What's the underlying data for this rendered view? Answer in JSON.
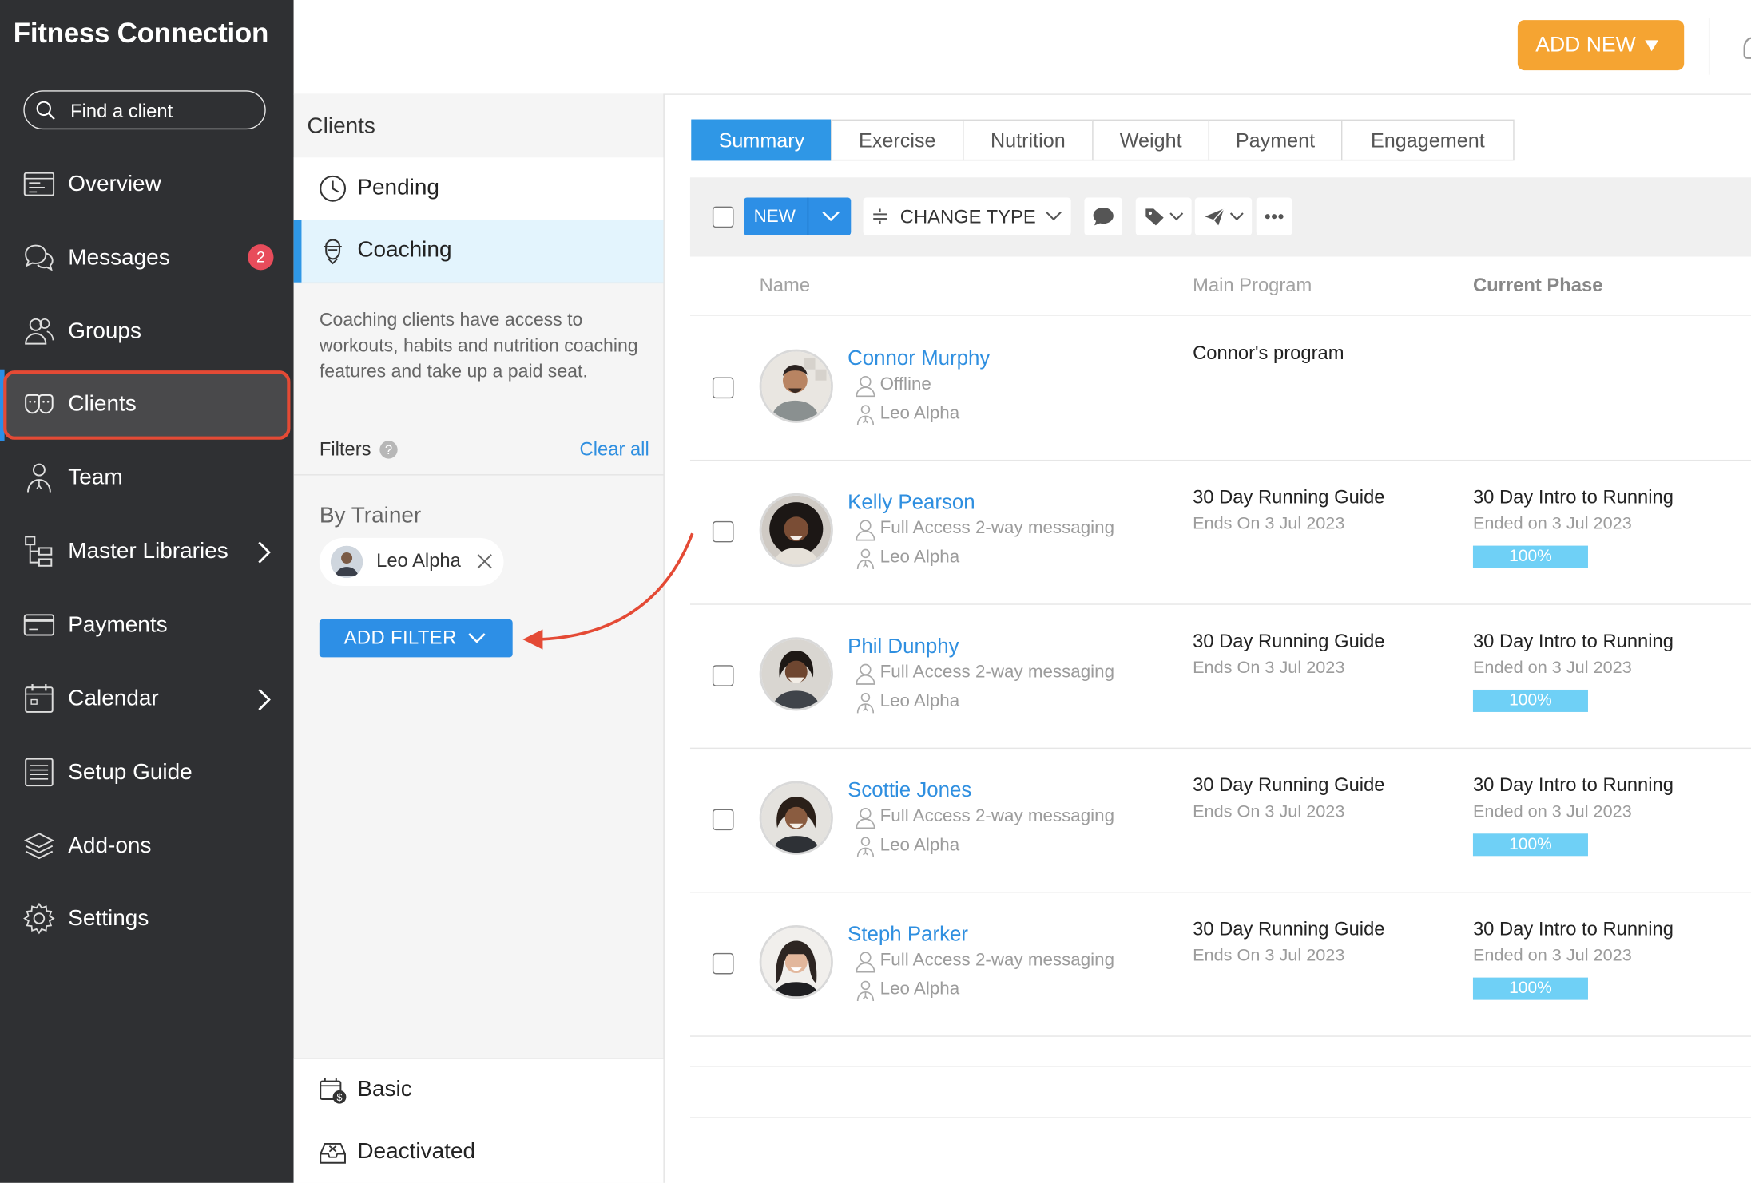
{
  "app": {
    "title": "Fitness Connection",
    "search_placeholder": "Find a client"
  },
  "sidebar": {
    "items": [
      {
        "label": "Overview",
        "icon": "overview-icon"
      },
      {
        "label": "Messages",
        "icon": "messages-icon",
        "badge": "2"
      },
      {
        "label": "Groups",
        "icon": "groups-icon"
      },
      {
        "label": "Clients",
        "icon": "clients-icon",
        "active": true
      },
      {
        "label": "Team",
        "icon": "team-icon"
      },
      {
        "label": "Master Libraries",
        "icon": "master-libraries-icon",
        "has_submenu": true
      },
      {
        "label": "Payments",
        "icon": "payments-icon"
      },
      {
        "label": "Calendar",
        "icon": "calendar-icon",
        "has_submenu": true
      },
      {
        "label": "Setup Guide",
        "icon": "setup-guide-icon"
      },
      {
        "label": "Add-ons",
        "icon": "add-ons-icon"
      },
      {
        "label": "Settings",
        "icon": "settings-icon"
      }
    ],
    "highlight_color": "#e44a35"
  },
  "topbar": {
    "add_new_label": "ADD NEW",
    "add_new_color": "#f5a432"
  },
  "clients_panel": {
    "title": "Clients",
    "segments": [
      {
        "label": "Pending",
        "icon": "clock-icon"
      },
      {
        "label": "Coaching",
        "icon": "coaching-icon",
        "selected": true
      }
    ],
    "description": "Coaching clients have access to workouts, habits and nutrition coaching features and take up a paid seat.",
    "filters_label": "Filters",
    "help_glyph": "?",
    "clear_all_label": "Clear all",
    "by_trainer_label": "By Trainer",
    "trainer_chip": "Leo Alpha",
    "add_filter_label": "ADD FILTER",
    "bottom_segments": [
      {
        "label": "Basic",
        "icon": "basic-plan-icon"
      },
      {
        "label": "Deactivated",
        "icon": "deactivated-icon"
      }
    ]
  },
  "tabs": [
    {
      "label": "Summary",
      "active": true
    },
    {
      "label": "Exercise"
    },
    {
      "label": "Nutrition"
    },
    {
      "label": "Weight"
    },
    {
      "label": "Payment"
    },
    {
      "label": "Engagement"
    }
  ],
  "toolbar": {
    "new_label": "NEW",
    "change_type_label": "CHANGE TYPE"
  },
  "table": {
    "columns": {
      "name": "Name",
      "main_program": "Main Program",
      "current_phase": "Current Phase"
    },
    "rows": [
      {
        "name": "Connor Murphy",
        "status": "Offline",
        "trainer": "Leo Alpha",
        "program": "Connor's program",
        "program_sub": "",
        "phase": "",
        "phase_sub": "",
        "progress": null
      },
      {
        "name": "Kelly Pearson",
        "status": "Full Access 2-way messaging",
        "trainer": "Leo Alpha",
        "program": "30 Day Running Guide",
        "program_sub": "Ends On 3 Jul 2023",
        "phase": "30 Day Intro to Running",
        "phase_sub": "Ended on 3 Jul 2023",
        "progress": 100,
        "progress_label": "100%"
      },
      {
        "name": "Phil Dunphy",
        "status": "Full Access 2-way messaging",
        "trainer": "Leo Alpha",
        "program": "30 Day Running Guide",
        "program_sub": "Ends On 3 Jul 2023",
        "phase": "30 Day Intro to Running",
        "phase_sub": "Ended on 3 Jul 2023",
        "progress": 100,
        "progress_label": "100%"
      },
      {
        "name": "Scottie Jones",
        "status": "Full Access 2-way messaging",
        "trainer": "Leo Alpha",
        "program": "30 Day Running Guide",
        "program_sub": "Ends On 3 Jul 2023",
        "phase": "30 Day Intro to Running",
        "phase_sub": "Ended on 3 Jul 2023",
        "progress": 100,
        "progress_label": "100%"
      },
      {
        "name": "Steph Parker",
        "status": "Full Access 2-way messaging",
        "trainer": "Leo Alpha",
        "program": "30 Day Running Guide",
        "program_sub": "Ends On 3 Jul 2023",
        "phase": "30 Day Intro to Running",
        "phase_sub": "Ended on 3 Jul 2023",
        "progress": 100,
        "progress_label": "100%"
      }
    ]
  },
  "colors": {
    "accent": "#2f97e6",
    "link": "#2f8fe0",
    "progress": "#6fd0f6",
    "annotation_arrow": "#e44a35"
  }
}
